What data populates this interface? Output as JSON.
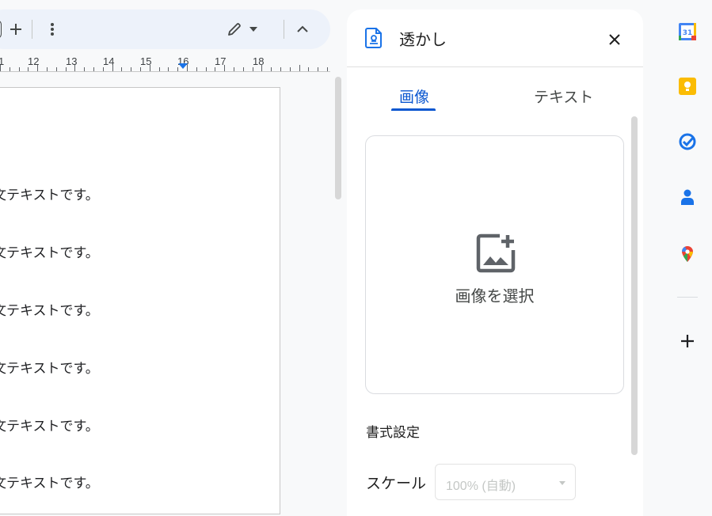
{
  "document": {
    "lines": [
      "文テキストです。",
      "文テキストです。",
      "文テキストです。",
      "文テキストです。",
      "文テキストです。",
      "文テキストです。"
    ]
  },
  "ruler": {
    "numbers": [
      "1",
      "12",
      "13",
      "14",
      "15",
      "16",
      "17",
      "18"
    ]
  },
  "toolbar": {
    "icons": [
      "plus-icon",
      "more-vert-icon",
      "pencil-icon",
      "dropdown-caret-icon",
      "chevron-up-icon"
    ]
  },
  "panel": {
    "title": "透かし",
    "tabs": [
      {
        "label": "画像",
        "selected": true
      },
      {
        "label": "テキスト",
        "selected": false
      }
    ],
    "dropzone_label": "画像を選択",
    "format_label": "書式設定",
    "scale": {
      "label": "スケール",
      "value": "100% (自動)",
      "disabled": true
    }
  },
  "side_apps": [
    "Calendar",
    "Keep",
    "Tasks",
    "Contacts",
    "Maps"
  ],
  "colors": {
    "accent": "#0b57d0",
    "toolbar_bg": "#edf2fa",
    "calendar_blue": "#4285f4",
    "keep_yellow": "#fbbc04",
    "tasks_blue": "#1a73e8",
    "maps_red": "#ea4335",
    "maps_green": "#34a853"
  }
}
